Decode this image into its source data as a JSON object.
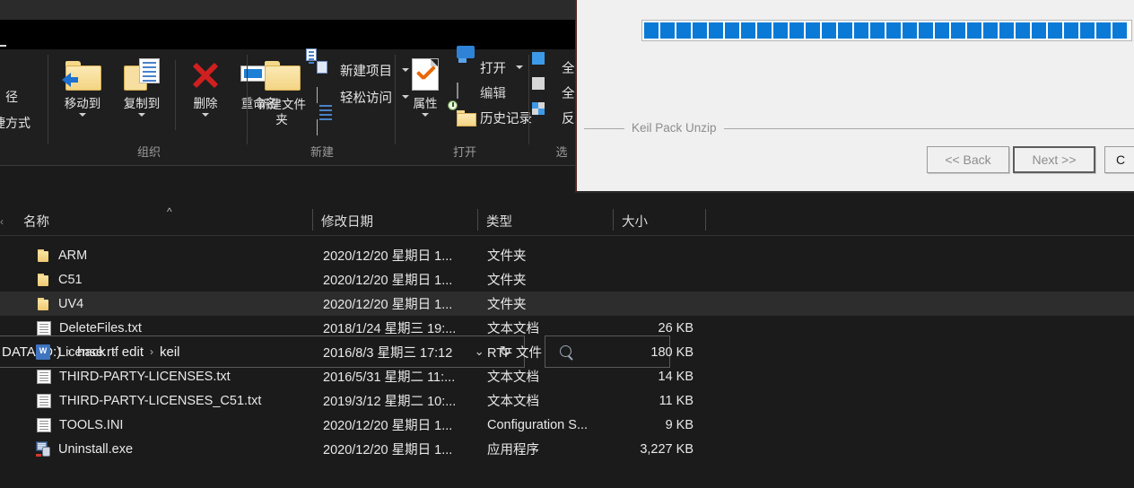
{
  "explorer": {
    "ribbon": {
      "groups": [
        {
          "name": "组织",
          "buttons": [
            {
              "label": "移动到",
              "icon": "move-to-icon"
            },
            {
              "label": "复制到",
              "icon": "copy-to-icon"
            },
            {
              "label": "删除",
              "icon": "delete-icon"
            },
            {
              "label": "重命名",
              "icon": "rename-icon"
            }
          ]
        },
        {
          "name": "新建",
          "buttons": [
            {
              "label": "新建文件夹",
              "icon": "new-folder-icon"
            },
            {
              "label": "新建项目",
              "icon": "new-item-icon"
            },
            {
              "label": "轻松访问",
              "icon": "easy-access-icon"
            }
          ]
        },
        {
          "name": "打开",
          "buttons": [
            {
              "label": "属性",
              "icon": "properties-icon"
            },
            {
              "label": "打开",
              "icon": "open-folder-icon"
            },
            {
              "label": "编辑",
              "icon": "edit-icon"
            },
            {
              "label": "历史记录",
              "icon": "history-icon"
            }
          ]
        },
        {
          "name": "选",
          "buttons": [
            {
              "label": "全部",
              "icon": "select-all-icon"
            },
            {
              "label": "全部",
              "icon": "select-none-icon"
            },
            {
              "label": "反向",
              "icon": "invert-selection-icon"
            }
          ]
        }
      ],
      "cut_left_labels": [
        "径",
        "捷方式"
      ]
    },
    "address": {
      "crumbs": [
        "DATA (D:)",
        "hack",
        "edit",
        "keil"
      ],
      "separator": "›",
      "dropdown_icon": "chevron-down-icon",
      "refresh_icon": "refresh-icon",
      "search_icon": "search-icon",
      "search_placeholder": ""
    },
    "list": {
      "columns": [
        "名称",
        "修改日期",
        "类型",
        "大小"
      ],
      "sort_indicator": "^",
      "rows": [
        {
          "name": "ARM",
          "date": "2020/12/20 星期日 1...",
          "type": "文件夹",
          "size": "",
          "icon": "folder-icon",
          "selected": false
        },
        {
          "name": "C51",
          "date": "2020/12/20 星期日 1...",
          "type": "文件夹",
          "size": "",
          "icon": "folder-icon",
          "selected": false
        },
        {
          "name": "UV4",
          "date": "2020/12/20 星期日 1...",
          "type": "文件夹",
          "size": "",
          "icon": "folder-icon",
          "selected": true
        },
        {
          "name": "DeleteFiles.txt",
          "date": "2018/1/24 星期三 19:...",
          "type": "文本文档",
          "size": "26 KB",
          "icon": "text-file-icon",
          "selected": false
        },
        {
          "name": "License.rtf",
          "date": "2016/8/3 星期三 17:12",
          "type": "RTF 文件",
          "size": "180 KB",
          "icon": "rtf-file-icon",
          "selected": false
        },
        {
          "name": "THIRD-PARTY-LICENSES.txt",
          "date": "2016/5/31 星期二 11:...",
          "type": "文本文档",
          "size": "14 KB",
          "icon": "text-file-icon",
          "selected": false
        },
        {
          "name": "THIRD-PARTY-LICENSES_C51.txt",
          "date": "2019/3/12 星期二 10:...",
          "type": "文本文档",
          "size": "11 KB",
          "icon": "text-file-icon",
          "selected": false
        },
        {
          "name": "TOOLS.INI",
          "date": "2020/12/20 星期日 1...",
          "type": "Configuration S...",
          "size": "9 KB",
          "icon": "text-file-icon",
          "selected": false
        },
        {
          "name": "Uninstall.exe",
          "date": "2020/12/20 星期日 1...",
          "type": "应用程序",
          "size": "3,227 KB",
          "icon": "exe-file-icon",
          "selected": false
        }
      ]
    }
  },
  "dialog": {
    "group_label": "Keil Pack Unzip",
    "progress": {
      "segments": 30,
      "percent": 97,
      "color": "#0b7ad6"
    },
    "buttons": [
      {
        "label": "<< Back",
        "enabled": false,
        "focused": false
      },
      {
        "label": "Next >>",
        "enabled": false,
        "focused": true
      },
      {
        "label": "C",
        "enabled": true,
        "focused": false
      }
    ]
  }
}
